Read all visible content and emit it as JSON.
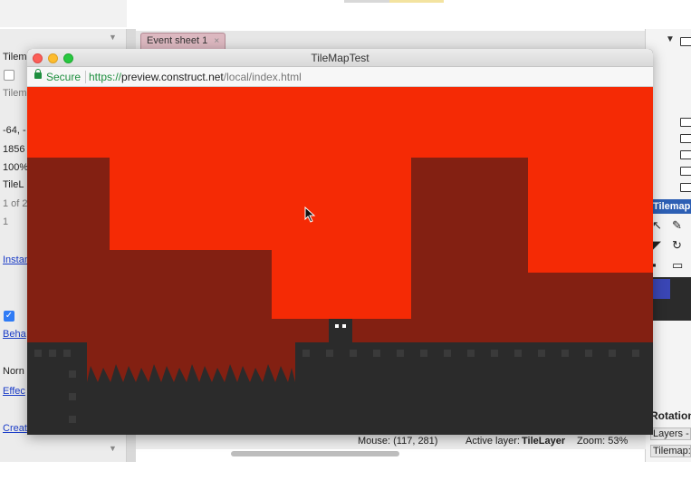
{
  "editor": {
    "event_tab_label": "Event sheet 1",
    "event_tab_close": "×",
    "left_panel_rows": [
      {
        "text": "Tilem",
        "style": "plain"
      },
      {
        "text": "Tilem",
        "style": "muted"
      },
      {
        "text": "-64, -",
        "style": "plain"
      },
      {
        "text": "1856",
        "style": "plain"
      },
      {
        "text": "100%",
        "style": "plain"
      },
      {
        "text": "TileL",
        "style": "plain"
      },
      {
        "text": "1 of 2",
        "style": "muted"
      },
      {
        "text": "1",
        "style": "muted"
      },
      {
        "text": "Instan",
        "style": "link"
      },
      {
        "text": "Beha",
        "style": "link"
      },
      {
        "text": "Norn",
        "style": "plain"
      },
      {
        "text": "Effec",
        "style": "link"
      },
      {
        "text": "Creat",
        "style": "link"
      }
    ],
    "right_panel": {
      "tilemap_header": "Tilemap: ",
      "rotation_label": "Rotation",
      "layers_tab": "Layers -",
      "tilemap_tab": "Tilemap: "
    },
    "status": {
      "mouse": "Mouse: (117, 281)",
      "active_layer_label": "Active layer:",
      "active_layer_value": "TileLayer",
      "zoom": "Zoom: 53%"
    }
  },
  "preview_window": {
    "title": "TileMapTest",
    "secure_label": "Secure",
    "url_scheme": "https://",
    "url_host": "preview.construct.net",
    "url_path": "/local/index.html"
  },
  "colors": {
    "sky": "#f52a05",
    "dark_red": "#832012",
    "ground": "#2b2b2b",
    "ground_dot": "#3a3a3a"
  }
}
